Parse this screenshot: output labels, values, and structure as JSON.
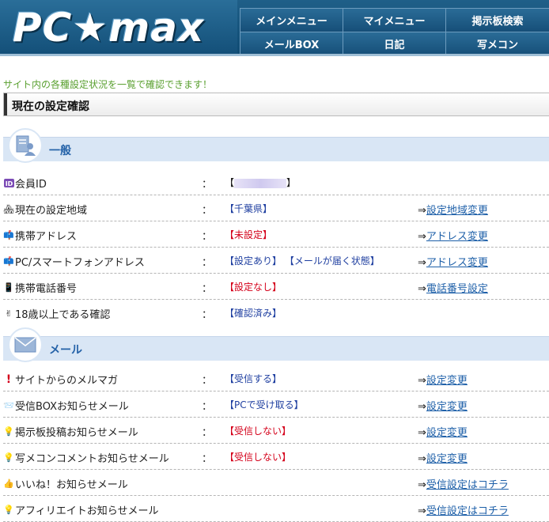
{
  "header": {
    "logo": "PC★max",
    "nav": [
      "メインメニュー",
      "マイメニュー",
      "掲示板検索",
      "メールBOX",
      "日記",
      "写メコン"
    ]
  },
  "intro": "サイト内の各種設定状況を一覧で確認できます！",
  "page_title": "現在の設定確認",
  "sections": [
    {
      "title": "一般",
      "icon": "document-person-icon",
      "rows": [
        {
          "icon": "id-badge-icon",
          "label": "会員ID",
          "value": "【 】",
          "link": ""
        },
        {
          "icon": "house-icon",
          "label": "現在の設定地域",
          "value": "【千葉県】",
          "link": "設定地域変更"
        },
        {
          "icon": "mailbox-icon",
          "label": "携帯アドレス",
          "value": "【未設定】",
          "link": "アドレス変更"
        },
        {
          "icon": "mailbox-icon",
          "label": "PC/スマートフォンアドレス",
          "value": "【設定あり】 【メールが届く状態】",
          "link": "アドレス変更"
        },
        {
          "icon": "mobile-phone-icon",
          "label": "携帯電話番号",
          "value": "【設定なし】",
          "link": "電話番号設定"
        },
        {
          "icon": "peace-hand-icon",
          "label": "18歳以上である確認",
          "value": "【確認済み】",
          "link": ""
        }
      ]
    },
    {
      "title": "メール",
      "icon": "envelope-icon",
      "rows": [
        {
          "icon": "exclamation-icon",
          "label": "サイトからのメルマガ",
          "value": "【受信する】",
          "link": "設定変更"
        },
        {
          "icon": "inbox-icon",
          "label": "受信BOXお知らせメール",
          "value": "【PCで受け取る】",
          "link": "設定変更"
        },
        {
          "icon": "lightbulb-icon",
          "label": "掲示板投稿お知らせメール",
          "value": "【受信しない】",
          "link": "設定変更"
        },
        {
          "icon": "lightbulb-icon",
          "label": "写メコンコメントお知らせメール",
          "value": "【受信しない】",
          "link": "設定変更"
        },
        {
          "icon": "thumbs-up-icon",
          "label": "いいね！お知らせメール",
          "value": "",
          "link": "受信設定はコチラ"
        },
        {
          "icon": "lightbulb-icon",
          "label": "アフィリエイトお知らせメール",
          "value": "",
          "link": "受信設定はコチラ"
        }
      ]
    }
  ],
  "colon": "：",
  "arrow": "⇒",
  "colors": {
    "header": "#164f78",
    "section_bg": "#d9e6f5",
    "section_title": "#2462a8",
    "link": "#1d5fa8",
    "blue_value": "#1f3fa0",
    "red_value": "#d4001a",
    "intro": "#5aa030"
  }
}
